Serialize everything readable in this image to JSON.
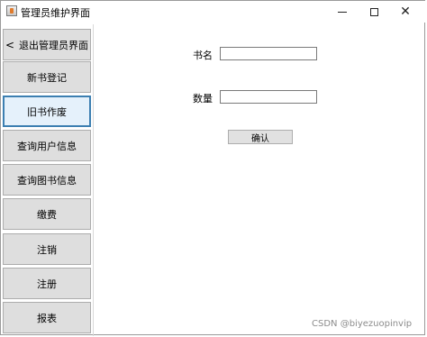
{
  "window": {
    "title": "管理员维护界面",
    "controls": {
      "minimize": "minimize",
      "maximize": "maximize",
      "close": "✕"
    }
  },
  "sidebar": {
    "items": [
      {
        "label": "退出管理员界面",
        "icon": "chevron-left-icon",
        "glyph": "<"
      },
      {
        "label": "新书登记"
      },
      {
        "label": "旧书作废",
        "selected": true
      },
      {
        "label": "查询用户信息"
      },
      {
        "label": "查询图书信息"
      },
      {
        "label": "缴费"
      },
      {
        "label": "注销"
      },
      {
        "label": "注册"
      },
      {
        "label": "报表"
      }
    ]
  },
  "form": {
    "book_name_label": "书名",
    "book_name_value": "",
    "quantity_label": "数量",
    "quantity_value": "",
    "confirm_label": "确认"
  },
  "watermark": "CSDN @biyezuopinvip",
  "colors": {
    "button_bg": "#dedede",
    "selected_border": "#3c7fb1",
    "selected_bg": "#e5f1fb"
  }
}
